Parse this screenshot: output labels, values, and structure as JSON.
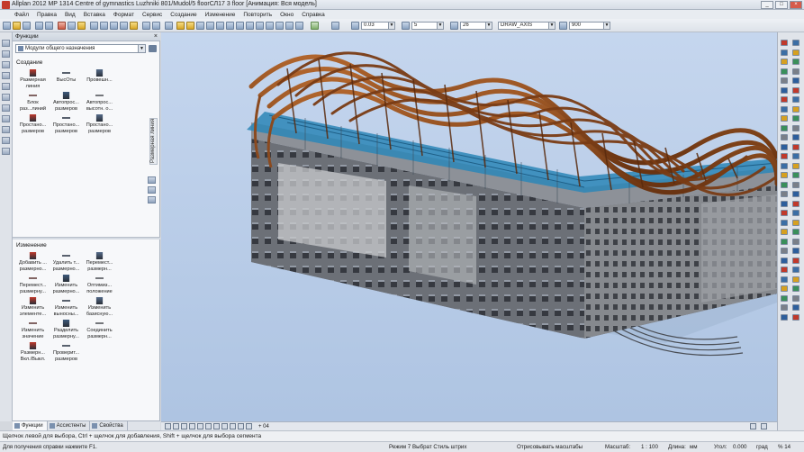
{
  "window": {
    "title": "Allplan 2012   MP 1314 Centre of gymnastics Luzhniki   801/Mudol/5 floorСЛ17   3 floor   [Анимация: Вся модель]",
    "buttons": [
      "_",
      "□",
      "×"
    ]
  },
  "menu": [
    "Файл",
    "Правка",
    "Вид",
    "Вставка",
    "Формат",
    "Сервис",
    "Создание",
    "Изменение",
    "Повторить",
    "Окно",
    "Справка"
  ],
  "toolbar": {
    "pen_value": "0.03",
    "line_value": "5",
    "color_value": "26",
    "layer_value": "DRAW_AXIS",
    "scale_value": "900"
  },
  "functions_panel": {
    "header": "Функции",
    "module": "Модули общего назначения",
    "vertical_tab": "Размерная линия",
    "create_section": {
      "title": "Создание",
      "items": [
        {
          "label": "Размерная линия",
          "icon": "dimension-line-icon"
        },
        {
          "label": "ВысОты",
          "icon": "elevation-icon"
        },
        {
          "label": "Провешн...",
          "icon": "projection-icon"
        },
        {
          "label": "Блок раз...линий",
          "icon": "block-dimension-icon"
        },
        {
          "label": "Автопрос... размеров",
          "icon": "auto-dimension-icon"
        },
        {
          "label": "Автопрос... высотн. о...",
          "icon": "auto-elevation-icon"
        },
        {
          "label": "Простано... размеров",
          "icon": "place-dimension-icon"
        },
        {
          "label": "Простано... размеров",
          "icon": "place-dimension-2-icon"
        },
        {
          "label": "Простано... размеров",
          "icon": "place-dimension-3-icon"
        }
      ]
    },
    "modify_section": {
      "title": "Изменение",
      "items": [
        {
          "label": "Добавить ... размерно...",
          "icon": "add-point-icon"
        },
        {
          "label": "Удалить т... размерно...",
          "icon": "delete-point-icon"
        },
        {
          "label": "Перемест... размерн...",
          "icon": "move-point-icon"
        },
        {
          "label": "Перемест... размерну...",
          "icon": "move-dimension-icon"
        },
        {
          "label": "Изменить размерно...",
          "icon": "modify-dimension-icon"
        },
        {
          "label": "Оптимиз... положение",
          "icon": "optimize-icon"
        },
        {
          "label": "Изменить элементе...",
          "icon": "modify-element-icon"
        },
        {
          "label": "Изменить выносны...",
          "icon": "modify-extension-icon"
        },
        {
          "label": "Изменить базисную...",
          "icon": "modify-base-icon"
        },
        {
          "label": "Изменить значение",
          "icon": "modify-value-icon"
        },
        {
          "label": "Разделить размерну...",
          "icon": "split-dimension-icon"
        },
        {
          "label": "Соединить размерн...",
          "icon": "join-dimension-icon"
        },
        {
          "label": "Размерн... Вкл./Выкл.",
          "icon": "toggle-dimension-icon"
        },
        {
          "label": "Проверит... размеров",
          "icon": "check-dimension-icon"
        }
      ]
    },
    "tabs": [
      "Функции",
      "Ассистенты",
      "Свойства"
    ]
  },
  "viewport_bar": {
    "zoom_label": "+ 04"
  },
  "hint_text": "Щелчок левой для выбора, Ctrl + щелчок для добавления, Shift + щелчок для выбора сегмента",
  "status": {
    "left": "Для получения справки нажмите F1.",
    "mode": "Режим 7 Выбрат  Стиль штрих",
    "scale_label": "Отрисовывать масштабы",
    "scale_name": "Масштаб:",
    "scale_value": "1 : 100",
    "length_label": "Длина:",
    "length_unit": "мм",
    "angle_label": "Угол:",
    "angle_value": "0.000",
    "angle_unit": "град",
    "extra": "% 14"
  },
  "colors": {
    "viewport_bg": "#b9cce6",
    "roof_wood": "#8b4a1f",
    "facade": "#5b5f66",
    "glass_blue": "#2b86b7"
  }
}
